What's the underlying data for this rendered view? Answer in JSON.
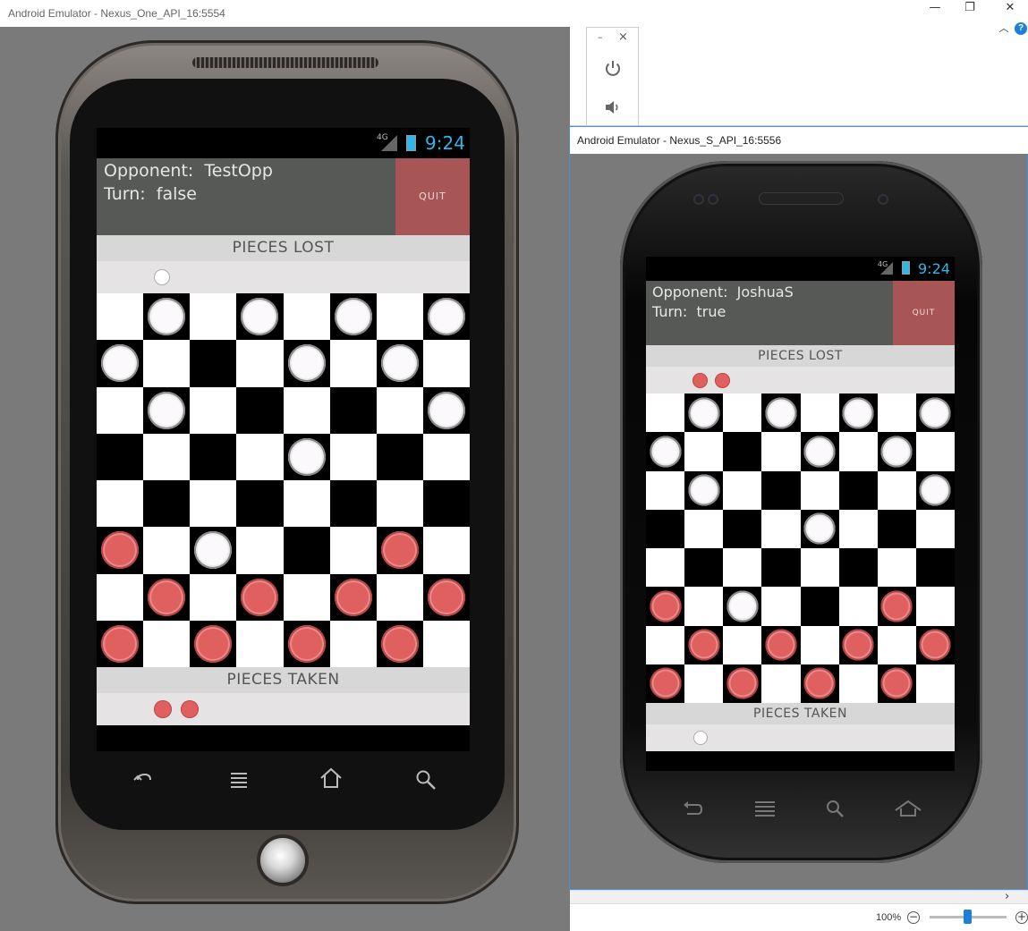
{
  "host": {
    "window_controls": [
      "—",
      "❐",
      "✕"
    ],
    "side_panel": {
      "minimize": "–",
      "close": "×",
      "power_icon": "power-icon",
      "volume_icon": "volume-icon"
    }
  },
  "windows": [
    {
      "title": "Android Emulator - Nexus_One_API_16:5554",
      "status": {
        "network": "4G",
        "time": "9:24"
      },
      "game": {
        "opponent_label": "Opponent:",
        "opponent": "TestOpp",
        "turn_label": "Turn:",
        "turn": "false",
        "quit": "QUIT",
        "pieces_lost_title": "PIECES LOST",
        "pieces_lost": [
          "white"
        ],
        "pieces_taken_title": "PIECES TAKEN",
        "pieces_taken": [
          "red",
          "red"
        ],
        "board": [
          "-w-w-w-w",
          "w---w-w-",
          "-w-----w",
          "----w---",
          "--------",
          "r-w---r-",
          "-r-r-r-r",
          "r-r-r-r-"
        ]
      },
      "nav": [
        "back-icon",
        "menu-icon",
        "home-icon",
        "search-icon"
      ]
    },
    {
      "title": "Android Emulator - Nexus_S_API_16:5556",
      "status": {
        "network": "4G",
        "time": "9:24"
      },
      "game": {
        "opponent_label": "Opponent:",
        "opponent": "JoshuaS",
        "turn_label": "Turn:",
        "turn": "true",
        "quit": "QUIT",
        "pieces_lost_title": "PIECES LOST",
        "pieces_lost": [
          "red",
          "red"
        ],
        "pieces_taken_title": "PIECES TAKEN",
        "pieces_taken": [
          "white"
        ],
        "board": [
          "-w-w-w-w",
          "w---w-w-",
          "-w-----w",
          "----w---",
          "--------",
          "r-w---r-",
          "-r-r-r-r",
          "r-r-r-r-"
        ]
      },
      "nav": [
        "back-icon",
        "menu-icon",
        "search-icon",
        "home-icon"
      ]
    }
  ],
  "zoom": {
    "level": "100%",
    "minus": "−",
    "plus": "+"
  },
  "scroll_arrow": "›",
  "colors": {
    "red_piece": "#e06060",
    "white_piece": "#fbf9fc",
    "quit": "#a85555",
    "header": "#575957",
    "accent": "#33b5e5"
  }
}
